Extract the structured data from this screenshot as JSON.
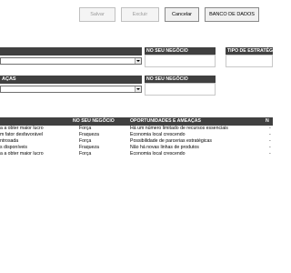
{
  "toolbar": {
    "save_label": "Salvar",
    "delete_label": "Excluir",
    "cancel_label": "Cancelar",
    "database_label": "BANCO DE DADOS"
  },
  "form": {
    "strength_section_label": "",
    "in_business_label_1": "NO SEU NEGÓCIO",
    "strategy_type_label": "TIPO DE ESTRATÉGIA",
    "opportunities_section_label": "AÇAS",
    "in_business_label_2": "NO SEU NEGÓCIO"
  },
  "table": {
    "headers": [
      "",
      "NO SEU NEGÓCIO",
      "OPORTUNIDADES E AMEAÇAS",
      "N"
    ],
    "rows": [
      [
        "a a obter maior lucro",
        "Força",
        "Há um número limitado de recursos essenciais",
        "-"
      ],
      [
        "m fator desfavorável",
        "Fraqueza",
        "Economia local crescendo",
        "-"
      ],
      [
        "ntrosada",
        "Força",
        "Possibilidade de parcerias estratégicas",
        "-"
      ],
      [
        "s disponíveis",
        "Fraqueza",
        "Não há novas linhas de produtos",
        "-"
      ],
      [
        "a a obter maior lucro",
        "Força",
        "Economia local crescendo",
        "-"
      ]
    ]
  }
}
